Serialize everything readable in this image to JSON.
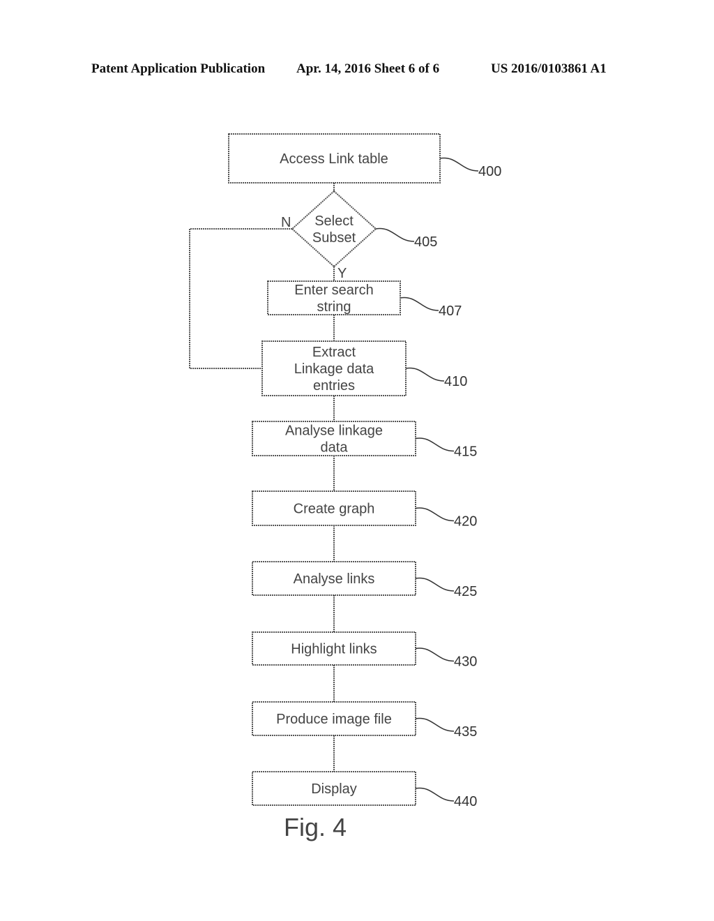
{
  "header": {
    "publication": "Patent Application Publication",
    "date_sheet": "Apr. 14, 2016  Sheet 6 of 6",
    "pub_number": "US 2016/0103861 A1"
  },
  "figure_label": "Fig. 4",
  "flowchart": {
    "steps": [
      {
        "id": "400",
        "type": "process",
        "lines": [
          "Access Link table"
        ]
      },
      {
        "id": "405",
        "type": "decision",
        "lines": [
          "Select",
          "Subset"
        ],
        "yes_label": "Y",
        "no_label": "N"
      },
      {
        "id": "407",
        "type": "process",
        "lines": [
          "Enter search",
          "string"
        ]
      },
      {
        "id": "410",
        "type": "process",
        "lines": [
          "Extract",
          "Linkage data",
          "entries"
        ]
      },
      {
        "id": "415",
        "type": "process",
        "lines": [
          "Analyse linkage",
          "data"
        ]
      },
      {
        "id": "420",
        "type": "process",
        "lines": [
          "Create graph"
        ]
      },
      {
        "id": "425",
        "type": "process",
        "lines": [
          "Analyse links"
        ]
      },
      {
        "id": "430",
        "type": "process",
        "lines": [
          "Highlight links"
        ]
      },
      {
        "id": "435",
        "type": "process",
        "lines": [
          "Produce image file"
        ]
      },
      {
        "id": "440",
        "type": "process",
        "lines": [
          "Display"
        ]
      }
    ],
    "edges": [
      {
        "from": "400",
        "to": "405"
      },
      {
        "from": "405",
        "to": "407",
        "label": "Y"
      },
      {
        "from": "405",
        "to": "410",
        "label": "N"
      },
      {
        "from": "407",
        "to": "410"
      },
      {
        "from": "410",
        "to": "415"
      },
      {
        "from": "415",
        "to": "420"
      },
      {
        "from": "420",
        "to": "425"
      },
      {
        "from": "425",
        "to": "430"
      },
      {
        "from": "430",
        "to": "435"
      },
      {
        "from": "435",
        "to": "440"
      }
    ]
  }
}
